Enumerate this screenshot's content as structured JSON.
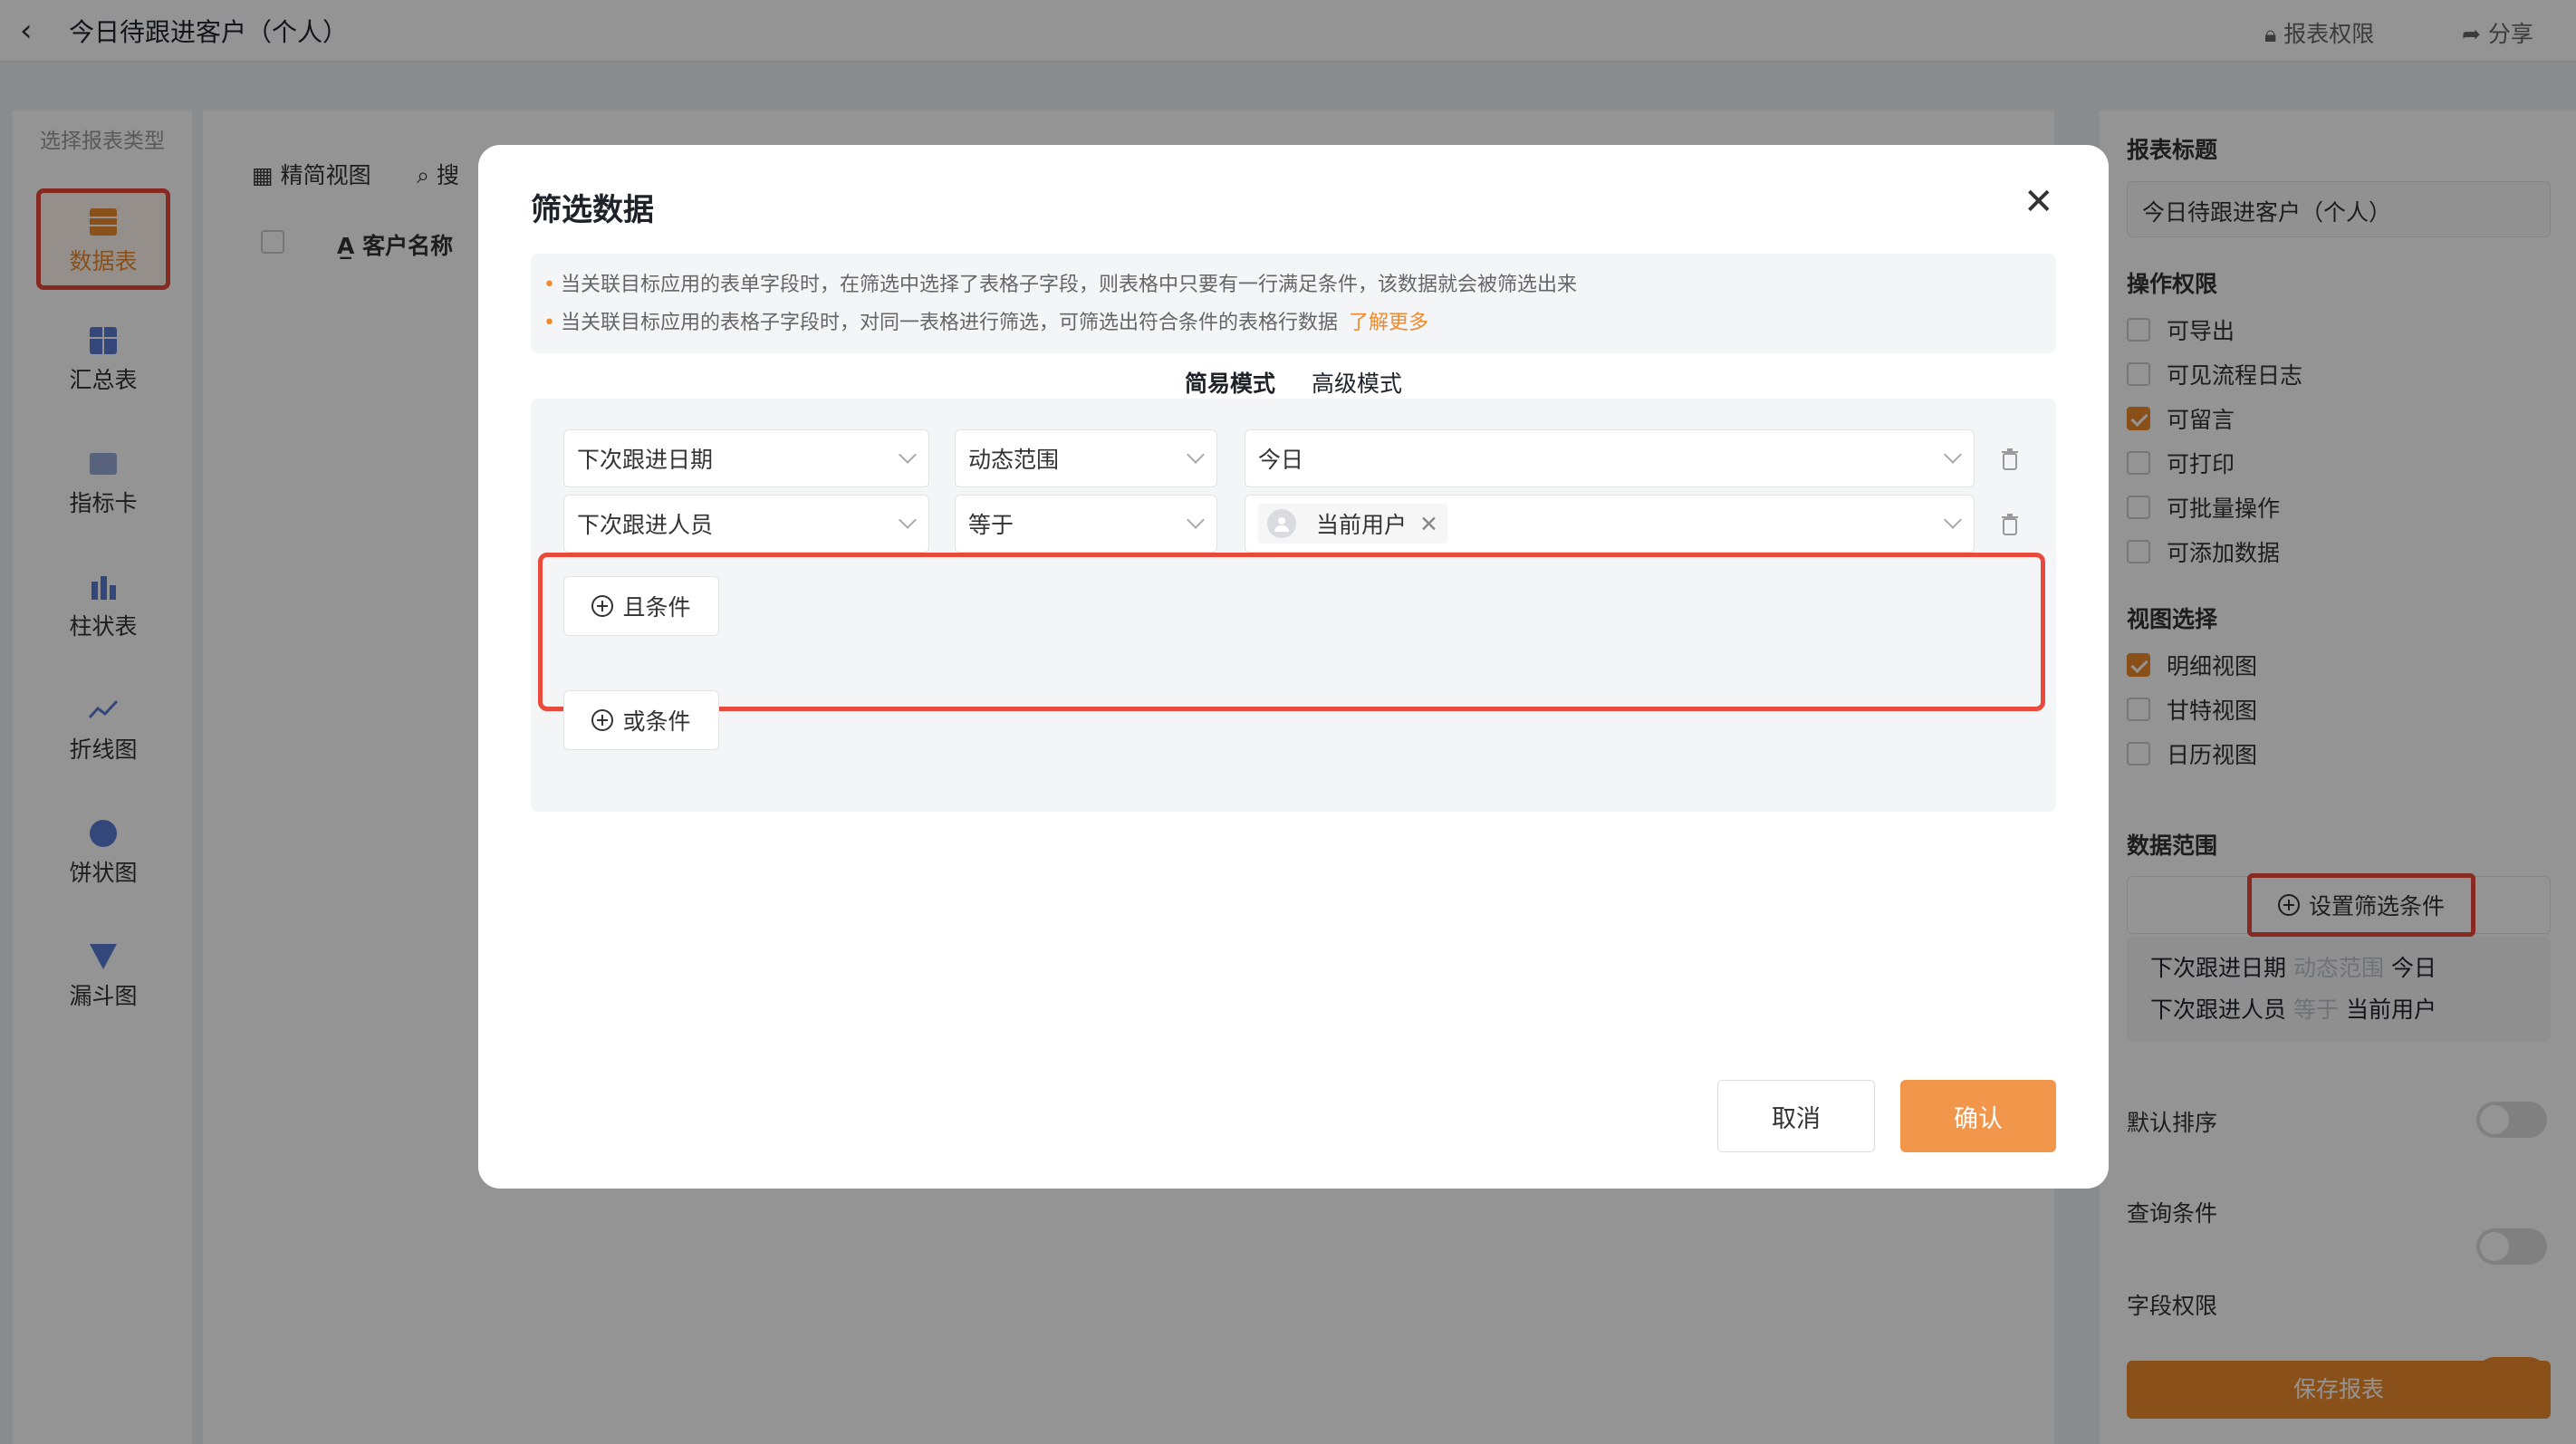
{
  "header": {
    "title": "今日待跟进客户（个人）",
    "report_permission": "报表权限",
    "share": "分享"
  },
  "type_panel": {
    "title": "选择报表类型",
    "items": [
      {
        "label": "数据表",
        "icon": "table-icon",
        "active": true
      },
      {
        "label": "汇总表",
        "icon": "summary-table-icon"
      },
      {
        "label": "指标卡",
        "icon": "metric-card-icon"
      },
      {
        "label": "柱状表",
        "icon": "bar-chart-icon"
      },
      {
        "label": "折线图",
        "icon": "line-chart-icon"
      },
      {
        "label": "饼状图",
        "icon": "pie-chart-icon"
      },
      {
        "label": "漏斗图",
        "icon": "funnel-chart-icon"
      }
    ]
  },
  "main": {
    "compact_view": "精简视图",
    "search": "搜",
    "col_customer": "客户名称"
  },
  "right_panel": {
    "report_title_label": "报表标题",
    "report_title_value": "今日待跟进客户（个人）",
    "op_perm_label": "操作权限",
    "op_perms": [
      {
        "label": "可导出",
        "checked": false
      },
      {
        "label": "可见流程日志",
        "checked": false
      },
      {
        "label": "可留言",
        "checked": true
      },
      {
        "label": "可打印",
        "checked": false
      },
      {
        "label": "可批量操作",
        "checked": false
      },
      {
        "label": "可添加数据",
        "checked": false
      }
    ],
    "view_label": "视图选择",
    "views": [
      {
        "label": "明细视图",
        "checked": true
      },
      {
        "label": "甘特视图",
        "checked": false
      },
      {
        "label": "日历视图",
        "checked": false
      }
    ],
    "data_range_label": "数据范围",
    "set_filter": "设置筛选条件",
    "conditions": [
      {
        "field": "下次跟进日期",
        "op": "动态范围",
        "value": "今日"
      },
      {
        "field": "下次跟进人员",
        "op": "等于",
        "value": "当前用户"
      }
    ],
    "default_sort": "默认排序",
    "query_cond": "查询条件",
    "field_perm": "字段权限",
    "save": "保存报表"
  },
  "modal": {
    "title": "筛选数据",
    "notice_1": "当关联目标应用的表单字段时，在筛选中选择了表格子字段，则表格中只要有一行满足条件，该数据就会被筛选出来",
    "notice_2": "当关联目标应用的表格子字段时，对同一表格进行筛选，可筛选出符合条件的表格行数据",
    "learn_more": "了解更多",
    "mode_simple": "简易模式",
    "mode_advanced": "高级模式",
    "row1": {
      "field": "下次跟进日期",
      "op": "动态范围",
      "value": "今日"
    },
    "row2": {
      "field": "下次跟进人员",
      "op": "等于",
      "value": "当前用户"
    },
    "and_cond": "且条件",
    "or_cond": "或条件",
    "cancel": "取消",
    "confirm": "确认"
  },
  "colors": {
    "accent": "#ee8a2e",
    "highlight": "#e84a3b"
  }
}
